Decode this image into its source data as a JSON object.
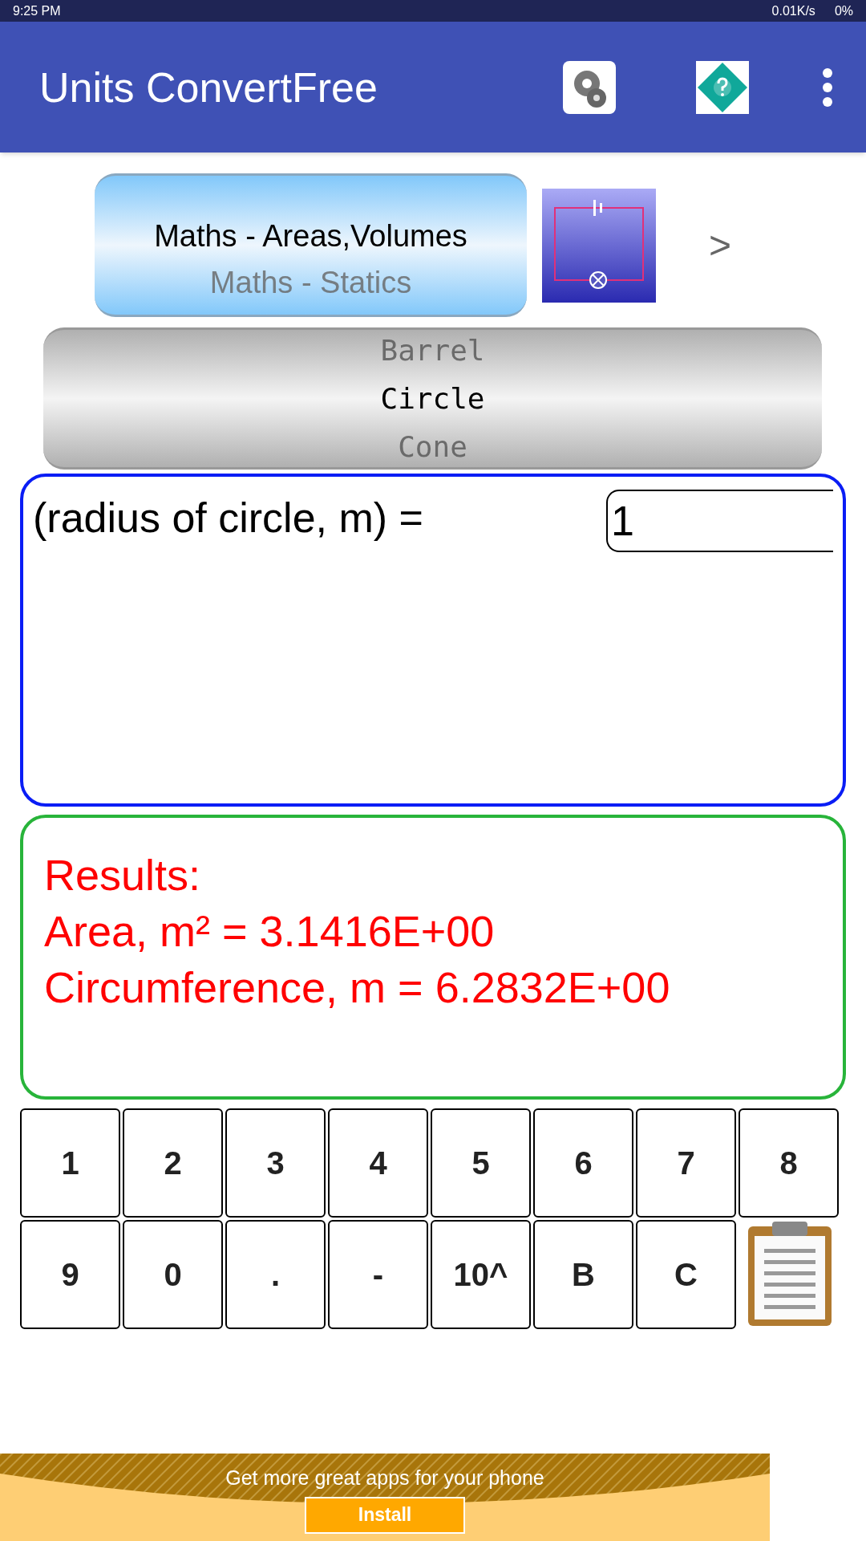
{
  "status_bar": {
    "time": "9:25 PM",
    "speed": "0.01K/s",
    "battery": "0%"
  },
  "toolbar": {
    "title": "Units ConvertFree"
  },
  "category_picker": {
    "items": [
      {
        "label": "Maths - Areas,Volumes",
        "selected": true
      },
      {
        "label": "Maths - Statics",
        "selected": false
      }
    ],
    "next": ">"
  },
  "shape_picker": {
    "items": [
      {
        "label": "Barrel",
        "selected": false
      },
      {
        "label": "Circle",
        "selected": true
      },
      {
        "label": "Cone",
        "selected": false
      }
    ]
  },
  "input": {
    "label": "(radius of circle, m) =",
    "value": "1"
  },
  "results": [
    "Results:",
    "Area, m² = 3.1416E+00",
    "Circumference, m = 6.2832E+00"
  ],
  "keypad": [
    [
      "1",
      "2",
      "3",
      "4",
      "5",
      "6",
      "7",
      "8"
    ],
    [
      "9",
      "0",
      ".",
      "-",
      "10^",
      "B",
      "C"
    ]
  ],
  "ad": {
    "text": "Get more great apps for your phone",
    "button": "Install"
  }
}
